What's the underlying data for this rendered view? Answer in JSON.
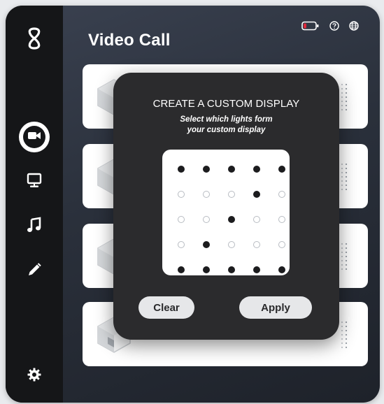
{
  "app": {
    "title": "Video Call"
  },
  "sidebar": {
    "logo_icon": "infinity-logo-icon",
    "items": [
      {
        "name": "video-call",
        "icon": "video-camera-icon",
        "active": true
      },
      {
        "name": "screen",
        "icon": "monitor-icon",
        "active": false
      },
      {
        "name": "music",
        "icon": "music-note-icon",
        "active": false
      },
      {
        "name": "draw",
        "icon": "pencil-icon",
        "active": false
      }
    ],
    "settings_icon": "gear-icon"
  },
  "top_icons": [
    "battery-low-icon",
    "help-icon",
    "globe-icon"
  ],
  "modal": {
    "title": "CREATE A CUSTOM DISPLAY",
    "subtitle_line1": "Select which lights form",
    "subtitle_line2": "your custom display",
    "grid": [
      [
        1,
        1,
        1,
        1,
        1
      ],
      [
        0,
        0,
        0,
        1,
        0
      ],
      [
        0,
        0,
        1,
        0,
        0
      ],
      [
        0,
        1,
        0,
        0,
        0
      ],
      [
        1,
        1,
        1,
        1,
        1
      ]
    ],
    "clear_label": "Clear",
    "apply_label": "Apply"
  },
  "colors": {
    "sidebar": "#151618",
    "modal": "#2b2b2d",
    "battery_accent": "#e0283a"
  }
}
